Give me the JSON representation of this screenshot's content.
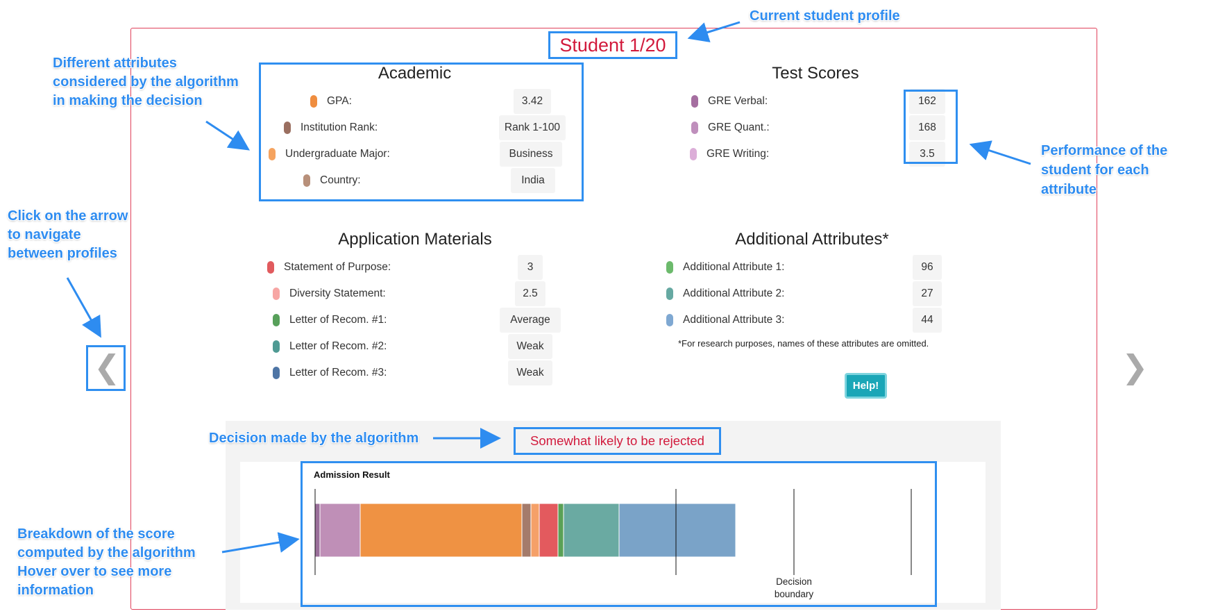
{
  "header": {
    "student_label": "Student 1/20"
  },
  "sections": {
    "academic": {
      "title": "Academic",
      "rows": [
        {
          "label": "GPA:",
          "value": "3.42",
          "color": "#ef8d3f"
        },
        {
          "label": "Institution Rank:",
          "value": "Rank 1-100",
          "color": "#9a6f60"
        },
        {
          "label": "Undergraduate Major:",
          "value": "Business",
          "color": "#f5a35f"
        },
        {
          "label": "Country:",
          "value": "India",
          "color": "#b8907a"
        }
      ]
    },
    "test_scores": {
      "title": "Test Scores",
      "rows": [
        {
          "label": "GRE Verbal:",
          "value": "162",
          "color": "#a56ea0"
        },
        {
          "label": "GRE Quant.:",
          "value": "168",
          "color": "#bf8fbc"
        },
        {
          "label": "GRE Writing:",
          "value": "3.5",
          "color": "#dcaed8"
        }
      ]
    },
    "application_materials": {
      "title": "Application Materials",
      "rows": [
        {
          "label": "Statement of Purpose:",
          "value": "3",
          "color": "#e15b5e"
        },
        {
          "label": "Diversity Statement:",
          "value": "2.5",
          "color": "#f7a6a4"
        },
        {
          "label": "Letter of Recom. #1:",
          "value": "Average",
          "color": "#57a05a"
        },
        {
          "label": "Letter of Recom. #2:",
          "value": "Weak",
          "color": "#4f9a93"
        },
        {
          "label": "Letter of Recom. #3:",
          "value": "Weak",
          "color": "#4e75a5"
        }
      ]
    },
    "additional": {
      "title": "Additional Attributes*",
      "rows": [
        {
          "label": "Additional Attribute 1:",
          "value": "96",
          "color": "#6cba6c"
        },
        {
          "label": "Additional Attribute 2:",
          "value": "27",
          "color": "#66a9a2"
        },
        {
          "label": "Additional Attribute 3:",
          "value": "44",
          "color": "#7fa8d2"
        }
      ],
      "footnote": "*For research purposes, names of these attributes are omitted."
    }
  },
  "help_button": "Help!",
  "decision": "Somewhat likely to be rejected",
  "chart": {
    "title": "Admission Result",
    "boundary_label_1": "Decision",
    "boundary_label_2": "boundary",
    "segments": [
      {
        "color": "#9a6f9a",
        "width": 7
      },
      {
        "color": "#bf8fb7",
        "width": 58
      },
      {
        "color": "#ef9243",
        "width": 233
      },
      {
        "color": "#a47b6b",
        "width": 13
      },
      {
        "color": "#f5a068",
        "width": 12
      },
      {
        "color": "#e35a5e",
        "width": 27
      },
      {
        "color": "#5aa156",
        "width": 8
      },
      {
        "color": "#6aaaa2",
        "width": 80
      },
      {
        "color": "#7aa3c8",
        "width": 168
      }
    ]
  },
  "annotations": {
    "current_profile": "Current student profile",
    "attributes_1": "Different attributes",
    "attributes_2": "considered by the algorithm",
    "attributes_3": "in making the decision",
    "performance_1": "Performance of the",
    "performance_2": "student for each",
    "performance_3": "attribute",
    "navigate_1": "Click on the arrow",
    "navigate_2": "to navigate",
    "navigate_3": "between profiles",
    "decision": "Decision made by the algorithm",
    "breakdown_1": "Breakdown of the score",
    "breakdown_2": "computed by the algorithm",
    "breakdown_3": "Hover over to see more",
    "breakdown_4": "information"
  },
  "nav": {
    "prev_glyph": "❮",
    "next_glyph": "❯"
  }
}
